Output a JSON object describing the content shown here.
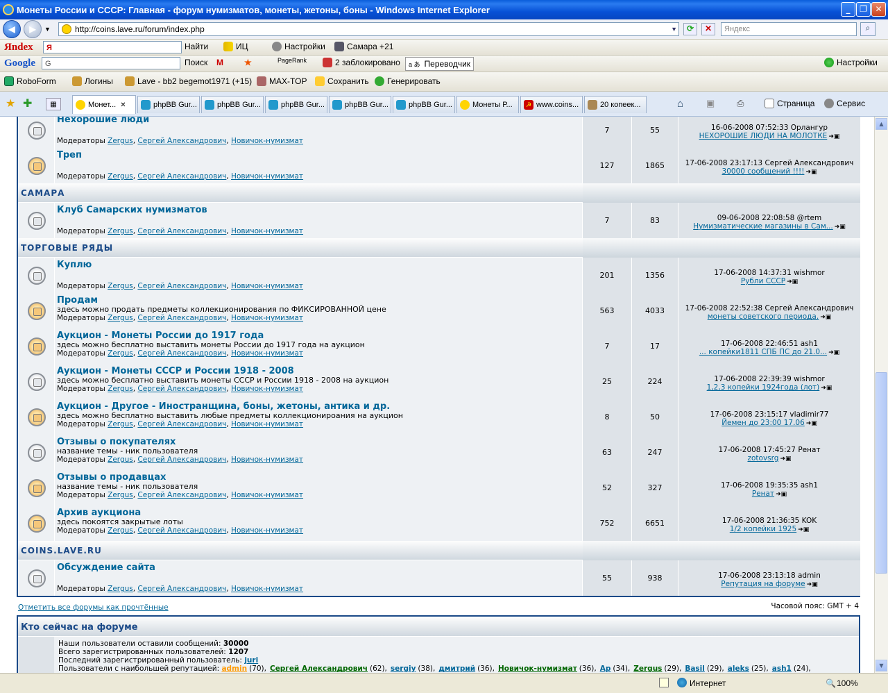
{
  "window": {
    "title": "Монеты России и СССР: Главная - форум нумизматов, монеты, жетоны, боны - Windows Internet Explorer"
  },
  "address": {
    "url": "http://coins.lave.ru/forum/index.php",
    "search_placeholder": "Яндекс"
  },
  "toolbars": {
    "yandex": {
      "logo": "Яndex",
      "search_value": "Я",
      "find": "Найти",
      "ic": "ИЦ",
      "settings": "Настройки",
      "weather": "Самара +21"
    },
    "google": {
      "logo": "Google",
      "search_value": "G",
      "search": "Поиск",
      "pagerank": "PageRank",
      "blocked": "2 заблокировано",
      "translator": "Переводчик",
      "settings": "Настройки"
    },
    "roboform": {
      "name": "RoboForm",
      "logins": "Логины",
      "lave": "Lave - bb2 begemot1971 (+15)",
      "maxtop": "MAX-TOP",
      "save": "Сохранить",
      "generate": "Генерировать"
    }
  },
  "tabs": [
    "Монет...",
    "phpBB Gur...",
    "phpBB Gur...",
    "phpBB Gur...",
    "phpBB Gur...",
    "phpBB Gur...",
    "Монеты Р...",
    "www.coins...",
    "20 копеек..."
  ],
  "tab_tools": {
    "page": "Страница",
    "service": "Сервис"
  },
  "forum": {
    "moderators_label": "Модераторы",
    "moderators": [
      "Zergus",
      "Сергей Александрович",
      "Новичок-нумизмат"
    ],
    "sections": [
      {
        "category": "",
        "forums": [
          {
            "name": "Нехорошие люди",
            "desc": "",
            "topics": "7",
            "posts": "55",
            "last_time": "16-06-2008 07:52:33 Орлангур",
            "last_topic": "НЕХОРОШИЕ ЛЮДИ НА МОЛОТКЕ",
            "new": false
          },
          {
            "name": "Треп",
            "desc": "",
            "topics": "127",
            "posts": "1865",
            "last_time": "17-06-2008 23:17:13 Сергей Александрович",
            "last_topic": "30000 сообщений !!!!",
            "new": true
          }
        ]
      },
      {
        "category": "САМАРА",
        "forums": [
          {
            "name": "Клуб Самарских нумизматов",
            "desc": "",
            "topics": "7",
            "posts": "83",
            "last_time": "09-06-2008 22:08:58 @rtem",
            "last_topic": "Нумизматические магазины в Сам...",
            "new": false
          }
        ]
      },
      {
        "category": "ТОРГОВЫЕ РЯДЫ",
        "forums": [
          {
            "name": "Куплю",
            "desc": "",
            "topics": "201",
            "posts": "1356",
            "last_time": "17-06-2008 14:37:31 wishmor",
            "last_topic": "Рубли СССР",
            "new": false
          },
          {
            "name": "Продам",
            "desc": "здесь можно продать предметы коллекционирования по ФИКСИРОВАННОЙ цене",
            "topics": "563",
            "posts": "4033",
            "last_time": "17-06-2008 22:52:38 Сергей Александрович",
            "last_topic": "монеты советского периода.",
            "new": true
          },
          {
            "name": "Аукцион - Монеты России до 1917 года",
            "desc": "здесь можно бесплатно выставить монеты России до 1917 года на аукцион",
            "topics": "7",
            "posts": "17",
            "last_time": "17-06-2008 22:46:51 ash1",
            "last_topic": "... копейки1811 СПБ ПС до 21.0...",
            "new": true
          },
          {
            "name": "Аукцион - Монеты СССР и России 1918 - 2008",
            "desc": "здесь можно бесплатно выставить монеты СССР и России 1918 - 2008 на аукцион",
            "topics": "25",
            "posts": "224",
            "last_time": "17-06-2008 22:39:39 wishmor",
            "last_topic": "1,2,3 копейки 1924года (лот)",
            "new": false
          },
          {
            "name": "Аукцион - Другое - Иностранщина, боны, жетоны, антика и др.",
            "desc": "здесь можно бесплатно выставить любые предметы коллекционироания на аукцион",
            "topics": "8",
            "posts": "50",
            "last_time": "17-06-2008 23:15:17 vladimir77",
            "last_topic": "Йемен до 23:00 17.06",
            "new": true
          },
          {
            "name": "Отзывы о покупателях",
            "desc": "название темы - ник пользователя",
            "topics": "63",
            "posts": "247",
            "last_time": "17-06-2008 17:45:27 Ренат",
            "last_topic": "zotovsrg",
            "new": false
          },
          {
            "name": "Отзывы о продавцах",
            "desc": "название темы - ник пользователя",
            "topics": "52",
            "posts": "327",
            "last_time": "17-06-2008 19:35:35 ash1",
            "last_topic": "Ренат",
            "new": true
          },
          {
            "name": "Архив аукциона",
            "desc": "здесь покоятся закрытые лоты",
            "topics": "752",
            "posts": "6651",
            "last_time": "17-06-2008 21:36:35 KOK",
            "last_topic": "1/2 копейки 1925",
            "new": true
          }
        ]
      },
      {
        "category": "COINS.LAVE.RU",
        "forums": [
          {
            "name": "Обсуждение сайта",
            "desc": "",
            "topics": "55",
            "posts": "938",
            "last_time": "17-06-2008 23:13:18 admin",
            "last_topic": "Репутация на форуме",
            "new": false
          }
        ]
      }
    ],
    "mark_read": "Отметить все форумы как прочтённые",
    "timezone": "Часовой пояс: GMT + 4"
  },
  "who": {
    "title": "Кто сейчас на форуме",
    "posts_label": "Наши пользователи оставили сообщений:",
    "posts_value": "30000",
    "users_label": "Всего зарегистрированных пользователей:",
    "users_value": "1207",
    "last_label": "Последний зарегистрированный пользователь:",
    "last_value": "juri",
    "rep_label": "Пользователи с наибольшей репутацией:",
    "rep_users": [
      {
        "name": "admin",
        "score": "(70),",
        "kind": "adm"
      },
      {
        "name": "Сергей Александрович",
        "score": "(62),",
        "kind": "mod"
      },
      {
        "name": "sergiy",
        "score": "(38),",
        "kind": ""
      },
      {
        "name": "дмитрий",
        "score": "(36),",
        "kind": ""
      },
      {
        "name": "Новичок-нумизмат",
        "score": "(36),",
        "kind": "mod"
      },
      {
        "name": "Ap",
        "score": "(34),",
        "kind": ""
      },
      {
        "name": "Zergus",
        "score": "(29),",
        "kind": "mod"
      },
      {
        "name": "Basil",
        "score": "(29),",
        "kind": ""
      },
      {
        "name": "aleks",
        "score": "(25),",
        "kind": ""
      },
      {
        "name": "ash1",
        "score": "(24),",
        "kind": ""
      }
    ]
  },
  "status": {
    "zone": "Интернет",
    "zoom": "100%"
  }
}
